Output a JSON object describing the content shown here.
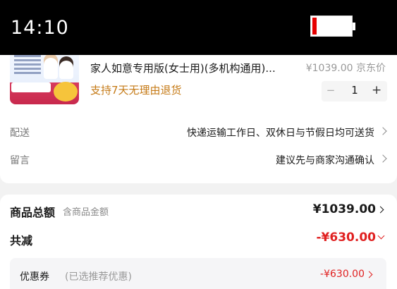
{
  "status_bar": {
    "time": "14:10"
  },
  "product": {
    "title": "家人如意专用版(女士用)(多机构通用)...",
    "promo": "支持7天无理由退货",
    "price": "¥1039.00 京东价",
    "quantity": "1",
    "minus_symbol": "−",
    "plus_symbol": "+"
  },
  "delivery": {
    "label": "配送",
    "value": "快递运输工作日、双休日与节假日均可送货"
  },
  "message": {
    "label": "留言",
    "value": "建议先与商家沟通确认"
  },
  "summary": {
    "total_label": "商品总额",
    "total_sub": "含商品金额",
    "total_value": "¥1039.00",
    "discount_label": "共减",
    "discount_value": "-¥630.00"
  },
  "coupon": {
    "label": "优惠券",
    "hint": "(已选推荐优惠)",
    "value": "-¥630.00"
  },
  "colors": {
    "accent_red": "#e02020",
    "promo_orange": "#c57a16"
  },
  "icons": [
    "battery-icon",
    "chevron-right-icon",
    "chevron-down-icon"
  ]
}
